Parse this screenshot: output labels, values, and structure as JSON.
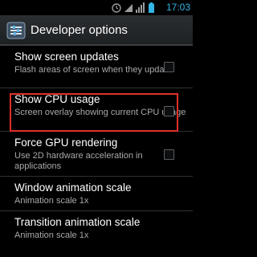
{
  "status_bar": {
    "time": "17:03",
    "icons": [
      "alarm-icon",
      "wifi-icon",
      "signal-icon",
      "battery-icon"
    ],
    "accent": "#33b5e5"
  },
  "action_bar": {
    "title": "Developer options",
    "icon": "settings-icon"
  },
  "preferences": [
    {
      "title": "Show screen updates",
      "summary": "Flash areas of screen when they update",
      "checkbox": true,
      "checked": false
    },
    {
      "title": "Show CPU usage",
      "summary": "Screen overlay showing current CPU usage",
      "checkbox": true,
      "checked": false,
      "highlighted": true
    },
    {
      "title": "Force GPU rendering",
      "summary": "Use 2D hardware acceleration in applications",
      "checkbox": true,
      "checked": false
    },
    {
      "title": "Window animation scale",
      "summary": "Animation scale 1x",
      "checkbox": false
    },
    {
      "title": "Transition animation scale",
      "summary": "Animation scale 1x",
      "checkbox": false
    }
  ],
  "colors": {
    "highlight_box": "#e0312a",
    "summary_text": "#a9a9a9"
  }
}
